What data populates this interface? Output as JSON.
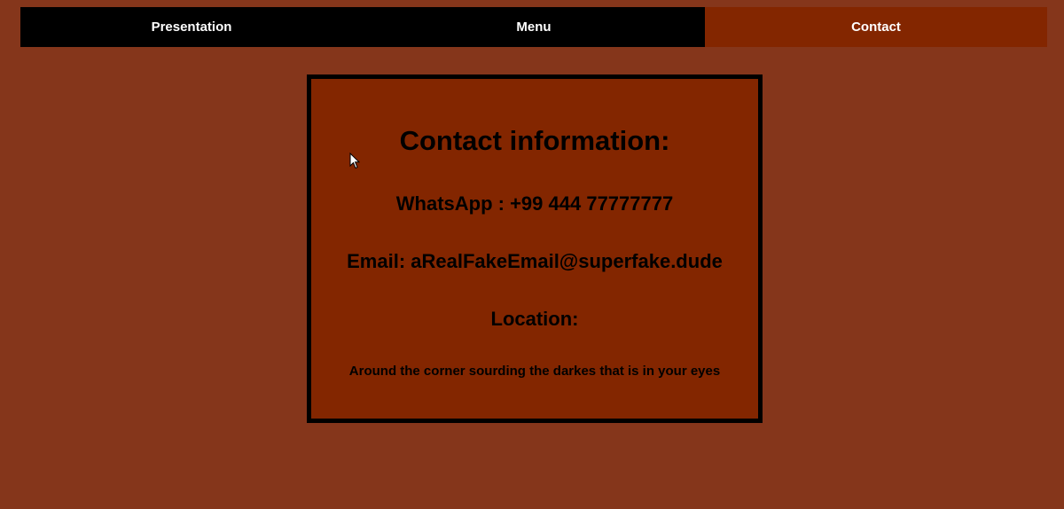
{
  "nav": {
    "items": [
      {
        "label": "Presentation"
      },
      {
        "label": "Menu"
      },
      {
        "label": "Contact"
      }
    ],
    "active": "Contact"
  },
  "contact": {
    "title": "Contact information:",
    "whatsapp": "WhatsApp : +99 444 77777777",
    "email": "Email: aRealFakeEmail@superfake.dude",
    "location_label": "Location:",
    "location_text": "Around the corner sourding the darkes that is in your eyes"
  },
  "colors": {
    "page_background": "#85361b",
    "nav_background": "#000000",
    "nav_active": "#832600",
    "card_background": "#832600",
    "card_border": "#000000"
  },
  "icons": [
    "mouse-pointer-icon"
  ]
}
